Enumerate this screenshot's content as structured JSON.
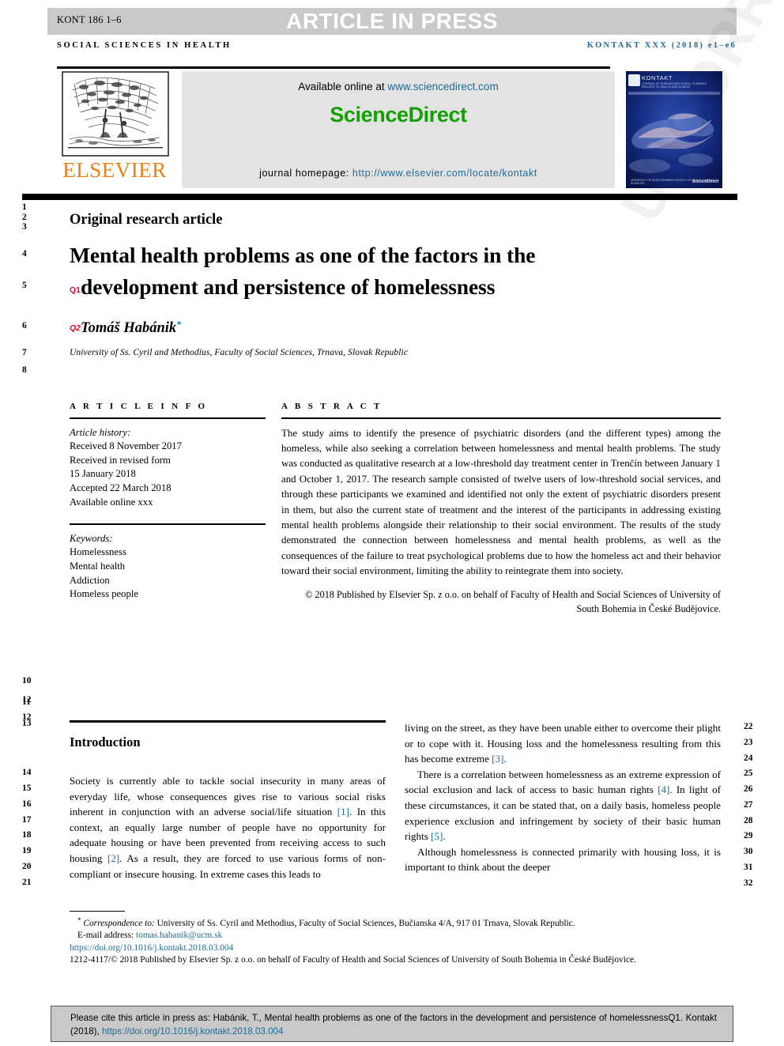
{
  "header": {
    "manuscript_code": "KONT 186 1–6",
    "article_in_press": "ARTICLE IN PRESS",
    "journal_section": "SOCIAL SCIENCES IN HEALTH",
    "journal_reference": "KONTAKT XXX (2018) e1–e6"
  },
  "masthead": {
    "elsevier_logotype": "ELSEVIER",
    "available_online_prefix": "Available online at ",
    "sciencedirect_url": "www.sciencedirect.com",
    "sciencedirect_wordmark": "ScienceDirect",
    "homepage_label": "journal homepage: ",
    "homepage_url": "http://www.elsevier.com/locate/kontakt",
    "cover": {
      "title": "KONTAKT",
      "subtitle": "JOURNAL OF NURSING AND SOCIAL SCIENCES RELATED TO HEALTH AND ILLNESS",
      "strip": "ČASOPIS PRO OŠETŘOVATELSTVÍ A SOCIÁLNÍ VĚDY VE ZDRAVÍ A NEMOCI",
      "publisher_footer": "UNIVERSITY OF SOUTH BOHEMIA FACULTY OF HEALTH AND SOCIAL SCIENCES",
      "sciencedirect_mark": "ScienceDirect"
    }
  },
  "article": {
    "kicker": "Original research article",
    "title_line1": "Mental health problems as one of the factors in the",
    "title_line2": "development and persistence of homelessness",
    "query_tag_title": "Q1",
    "query_tag_author": "Q2",
    "author": "Tomáš Habánik",
    "author_star": "*",
    "affiliation": "University of Ss. Cyril and Methodius, Faculty of Social Sciences, Trnava, Slovak Republic"
  },
  "article_info": {
    "heading": "A R T I C L E   I N F O",
    "history_label": "Article history:",
    "history": [
      "Received 8 November 2017",
      "Received in revised form",
      "15 January 2018",
      "Accepted 22 March 2018",
      "Available online xxx"
    ],
    "keywords_label": "Keywords:",
    "keywords": [
      "Homelessness",
      "Mental health",
      "Addiction",
      "Homeless people"
    ]
  },
  "abstract": {
    "heading": "A B S T R A C T",
    "body": "The study aims to identify the presence of psychiatric disorders (and the different types) among the homeless, while also seeking a correlation between homelessness and mental health problems. The study was conducted as qualitative research at a low-threshold day treatment center in Trenčín between January 1 and October 1, 2017. The research sample consisted of twelve users of low-threshold social services, and through these participants we examined and identified not only the extent of psychiatric disorders present in them, but also the current state of treatment and the interest of the participants in addressing existing mental health problems alongside their relationship to their social environment. The results of the study demonstrated the connection between homelessness and mental health problems, as well as the consequences of the failure to treat psychological problems due to how the homeless act and their behavior toward their social environment, limiting the ability to reintegrate them into society.",
    "copyright": "© 2018 Published by Elsevier Sp. z o.o. on behalf of Faculty of Health and Social Sciences of University of South Bohemia in České Budějovice."
  },
  "body": {
    "section_heading": "Introduction",
    "left_paragraph": "Society is currently able to tackle social insecurity in many areas of everyday life, whose consequences gives rise to various social risks inherent in conjunction with an adverse social/life situation [1]. In this context, an equally large number of people have no opportunity for adequate housing or have been prevented from receiving access to such housing [2]. As a result, they are forced to use various forms of non-compliant or insecure housing. In extreme cases this leads to",
    "right_paragraph_1": "living on the street, as they have been unable either to overcome their plight or to cope with it. Housing loss and the homelessness resulting from this has become extreme [3].",
    "right_paragraph_2": "There is a correlation between homelessness as an extreme expression of social exclusion and lack of access to basic human rights [4]. In light of these circumstances, it can be stated that, on a daily basis, homeless people experience exclusion and infringement by society of their basic human rights [5].",
    "right_paragraph_3": "Although homelessness is connected primarily with housing loss, it is important to think about the deeper"
  },
  "footnote": {
    "correspondence_mark": "*",
    "correspondence_label": "Correspondence to:",
    "correspondence_text": " University of Ss. Cyril and Methodius, Faculty of Social Sciences, Bučianska 4/A, 917 01 Trnava, Slovak Republic.",
    "email_label": "E-mail address:",
    "email": "tomas.habanik@ucm.sk",
    "doi": "https://doi.org/10.1016/j.kontakt.2018.03.004",
    "issn_line": "1212-4117/© 2018 Published by Elsevier Sp. z o.o. on behalf of Faculty of Health and Social Sciences of University of South Bohemia in České Budějovice."
  },
  "cite_box": {
    "text": "Please cite this article in press as: Habánik, T., Mental health problems as one of the factors in the development and persistence of homelessnessQ1. Kontakt (2018), ",
    "link": "https://doi.org/10.1016/j.kontakt.2018.03.004"
  },
  "line_numbers": {
    "left": [
      "1",
      "2",
      "3",
      "4",
      "5",
      "6",
      "7",
      "8",
      "10",
      "11",
      "12",
      "12",
      "13",
      "14",
      "15",
      "16",
      "17",
      "18",
      "19",
      "20",
      "21"
    ],
    "right": [
      "22",
      "23",
      "24",
      "25",
      "26",
      "27",
      "28",
      "29",
      "30",
      "31",
      "32"
    ]
  },
  "watermark": {
    "text": "UNCORRECTED PROOF"
  },
  "colors": {
    "link": "#1f6a94",
    "query_tag": "#e8002a",
    "sciencedirect_green": "#12a000",
    "elsevier_orange": "#ec8013",
    "banner_grey": "#c9c9c9",
    "sd_box_grey": "#e3e3e3",
    "cover_blue": "#0b1f6b"
  }
}
